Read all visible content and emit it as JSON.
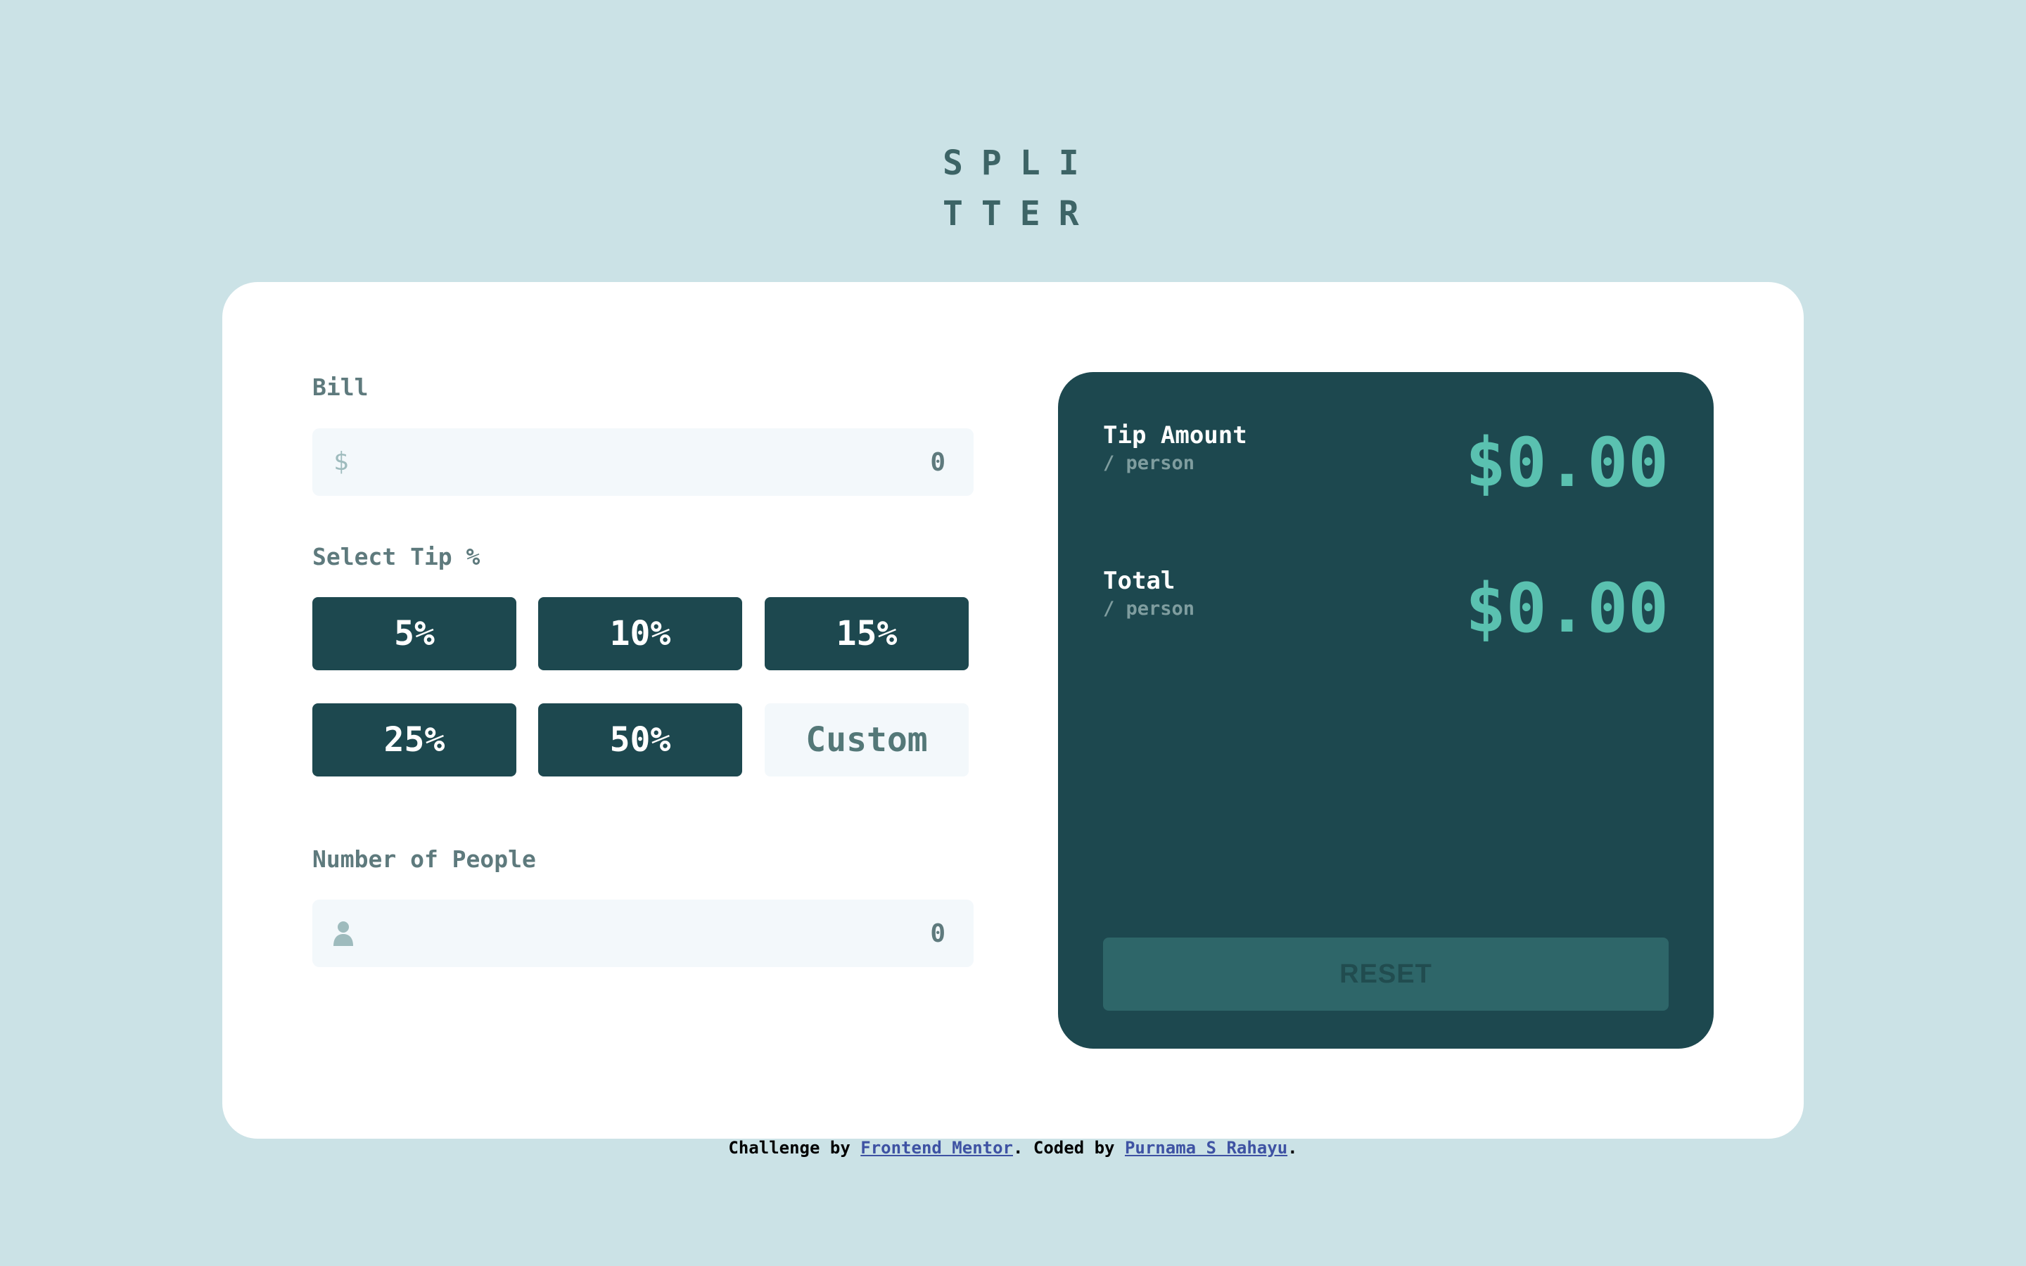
{
  "logo": {
    "line1": "SPLI",
    "line2": "TTER"
  },
  "bill": {
    "label": "Bill",
    "prefix": "$",
    "placeholder": "0"
  },
  "tip": {
    "label": "Select Tip %",
    "options": [
      "5%",
      "10%",
      "15%",
      "25%",
      "50%"
    ],
    "custom_label": "Custom"
  },
  "people": {
    "label": "Number of People",
    "placeholder": "0",
    "icon": "person-icon"
  },
  "results": {
    "tip_amount": {
      "title": "Tip Amount",
      "subtitle": "/ person",
      "value": "$0.00"
    },
    "total": {
      "title": "Total",
      "subtitle": "/ person",
      "value": "$0.00"
    },
    "reset_label": "RESET"
  },
  "footer": {
    "prefix": "Challenge by ",
    "link1": "Frontend Mentor",
    "middle": ". Coded by ",
    "link2": "Purnama S Rahayu",
    "suffix": "."
  },
  "colors": {
    "background": "#cbe2e6",
    "card": "#ffffff",
    "dark_cyan": "#1d484f",
    "accent": "#5ac1b0",
    "reset_bg": "#2e6669"
  }
}
